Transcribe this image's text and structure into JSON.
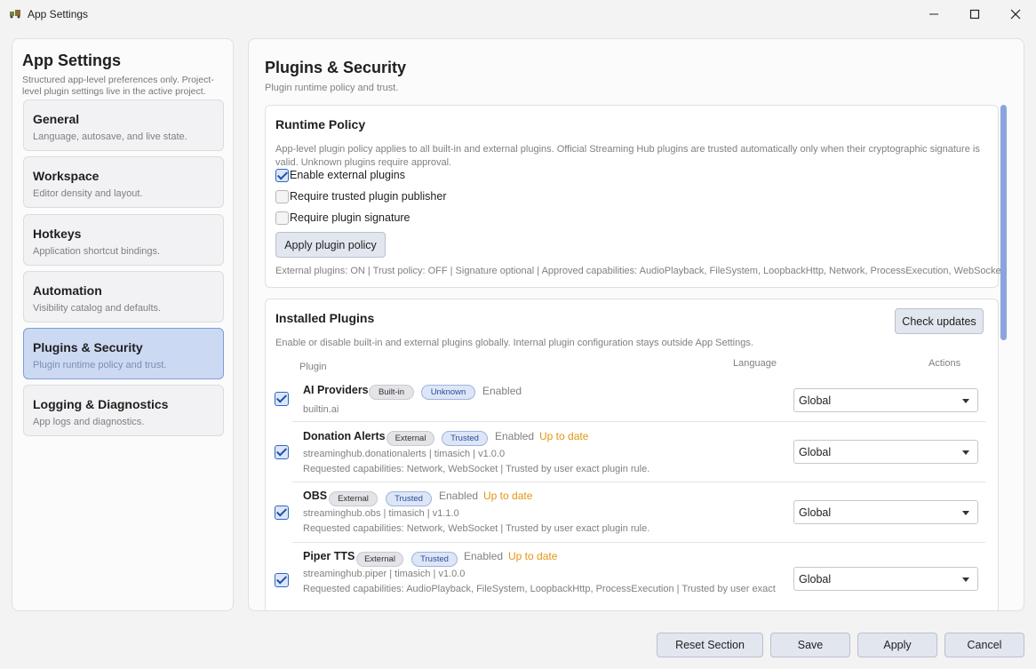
{
  "window": {
    "title": "App Settings"
  },
  "sidebar": {
    "title": "App Settings",
    "description": "Structured app-level preferences only. Project-level plugin settings live in the active project.",
    "items": [
      {
        "label": "General",
        "sub": "Language, autosave, and live state.",
        "active": false
      },
      {
        "label": "Workspace",
        "sub": "Editor density and layout.",
        "active": false
      },
      {
        "label": "Hotkeys",
        "sub": "Application shortcut bindings.",
        "active": false
      },
      {
        "label": "Automation",
        "sub": "Visibility catalog and defaults.",
        "active": false
      },
      {
        "label": "Plugins & Security",
        "sub": "Plugin runtime policy and trust.",
        "active": true
      },
      {
        "label": "Logging & Diagnostics",
        "sub": "App logs and diagnostics.",
        "active": false
      }
    ]
  },
  "main": {
    "title": "Plugins & Security",
    "subtitle": "Plugin runtime policy and trust."
  },
  "runtime_policy": {
    "title": "Runtime Policy",
    "description": "App-level plugin policy applies to all built-in and external plugins. Official Streaming Hub plugins are trusted automatically only when their cryptographic signature is valid. Unknown plugins require approval.",
    "options": [
      {
        "label": "Enable external plugins",
        "checked": true
      },
      {
        "label": "Require trusted plugin publisher",
        "checked": false
      },
      {
        "label": "Require plugin signature",
        "checked": false
      }
    ],
    "apply_label": "Apply plugin policy",
    "status": "External plugins: ON | Trust policy: OFF | Signature optional | Approved capabilities: AudioPlayback, FileSystem, LoopbackHttp, Network, ProcessExecution, WebSocket"
  },
  "installed": {
    "title": "Installed Plugins",
    "check_updates_label": "Check updates",
    "description": "Enable or disable built-in and external plugins globally. Internal plugin configuration stays outside App Settings.",
    "columns": {
      "plugin": "Plugin",
      "language": "Language",
      "actions": "Actions"
    },
    "plugins": [
      {
        "name": "AI Providers",
        "badges": [
          "Built-in",
          "Unknown"
        ],
        "status": "Enabled",
        "update": "",
        "meta": "builtin.ai",
        "caps": "",
        "language": "Global",
        "checked": true
      },
      {
        "name": "Donation Alerts",
        "badges": [
          "External",
          "Trusted"
        ],
        "status": "Enabled",
        "update": "Up to date",
        "meta": "streaminghub.donationalerts | timasich | v1.0.0",
        "caps": "Requested capabilities: Network, WebSocket | Trusted by user exact plugin rule.",
        "language": "Global",
        "checked": true
      },
      {
        "name": "OBS",
        "badges": [
          "External",
          "Trusted"
        ],
        "status": "Enabled",
        "update": "Up to date",
        "meta": "streaminghub.obs | timasich | v1.1.0",
        "caps": "Requested capabilities: Network, WebSocket | Trusted by user exact plugin rule.",
        "language": "Global",
        "checked": true
      },
      {
        "name": "Piper TTS",
        "badges": [
          "External",
          "Trusted"
        ],
        "status": "Enabled",
        "update": "Up to date",
        "meta": "streaminghub.piper | timasich | v1.0.0",
        "caps": "Requested capabilities: AudioPlayback, FileSystem, LoopbackHttp, ProcessExecution | Trusted by user exact",
        "language": "Global",
        "checked": true
      }
    ]
  },
  "footer": {
    "reset_label": "Reset Section",
    "save_label": "Save",
    "apply_label": "Apply",
    "cancel_label": "Cancel"
  },
  "colors": {
    "accent": "#2f65c6",
    "active_nav": "#ccd9f3",
    "update_orange": "#e39512"
  }
}
